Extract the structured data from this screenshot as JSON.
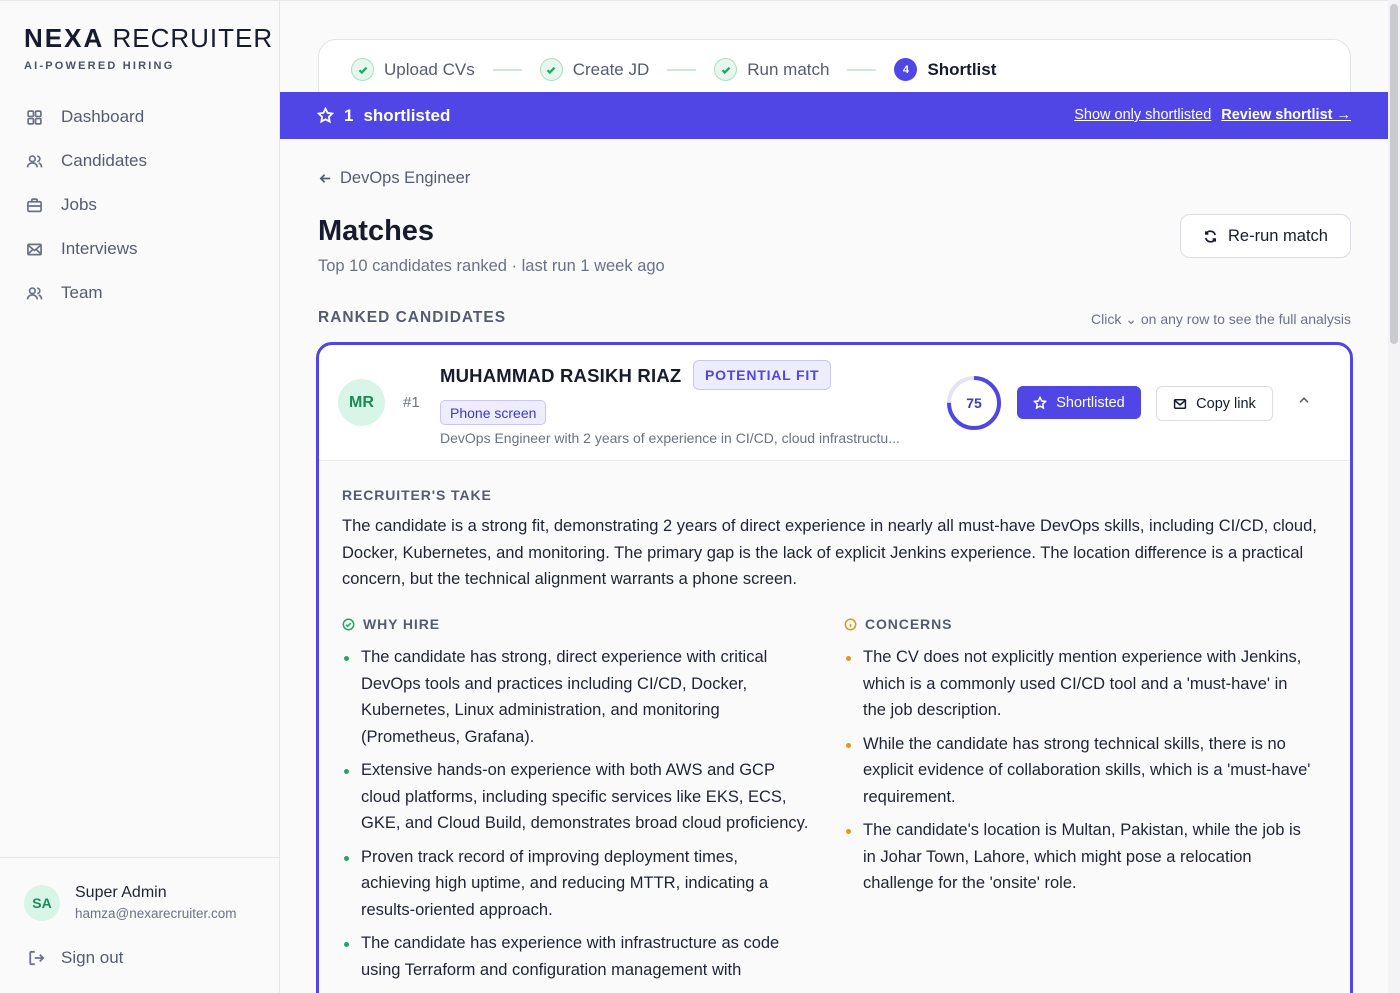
{
  "brand": {
    "name_bold": "NEXA",
    "name_rest": "RECRUITER",
    "tagline": "AI-POWERED HIRING"
  },
  "nav": [
    {
      "label": "Dashboard",
      "icon": "grid-icon"
    },
    {
      "label": "Candidates",
      "icon": "users-icon"
    },
    {
      "label": "Jobs",
      "icon": "briefcase-icon"
    },
    {
      "label": "Interviews",
      "icon": "mail-icon"
    },
    {
      "label": "Team",
      "icon": "team-icon"
    }
  ],
  "user": {
    "initials": "SA",
    "name": "Super Admin",
    "email": "hamza@nexarecruiter.com"
  },
  "signout_label": "Sign out",
  "stepper": {
    "steps": [
      {
        "label": "Upload CVs",
        "state": "done"
      },
      {
        "label": "Create JD",
        "state": "done"
      },
      {
        "label": "Run match",
        "state": "done"
      },
      {
        "label": "Shortlist",
        "state": "active",
        "number": "4"
      }
    ]
  },
  "banner": {
    "count": "1",
    "count_label": "shortlisted",
    "show_only_label": "Show only shortlisted",
    "review_label": "Review shortlist →"
  },
  "page": {
    "back_label": "DevOps Engineer",
    "title": "Matches",
    "subtitle": "Top 10 candidates ranked · last run 1 week ago",
    "rerun_label": "Re-run match",
    "section_label": "RANKED CANDIDATES",
    "hint": "Click ⌄ on any row to see the full analysis"
  },
  "candidate": {
    "initials": "MR",
    "rank": "#1",
    "name": "MUHAMMAD RASIKH RIAZ",
    "fit": "POTENTIAL FIT",
    "stage": "Phone screen",
    "summary": "DevOps Engineer with 2 years of experience in CI/CD, cloud infrastructu...",
    "score": 75,
    "score_label": "75",
    "shortlisted_label": "Shortlisted",
    "copy_link_label": "Copy link",
    "take_label": "RECRUITER'S TAKE",
    "take": "The candidate is a strong fit, demonstrating 2 years of direct experience in nearly all must-have DevOps skills, including CI/CD, cloud, Docker, Kubernetes, and monitoring. The primary gap is the lack of explicit Jenkins experience. The location difference is a practical concern, but the technical alignment warrants a phone screen.",
    "why_hire_label": "WHY HIRE",
    "why_hire": [
      "The candidate has strong, direct experience with critical DevOps tools and practices including CI/CD, Docker, Kubernetes, Linux administration, and monitoring (Prometheus, Grafana).",
      "Extensive hands-on experience with both AWS and GCP cloud platforms, including specific services like EKS, ECS, GKE, and Cloud Build, demonstrates broad cloud proficiency.",
      "Proven track record of improving deployment times, achieving high uptime, and reducing MTTR, indicating a results-oriented approach.",
      "The candidate has experience with infrastructure as code using Terraform and configuration management with"
    ],
    "concerns_label": "CONCERNS",
    "concerns": [
      "The CV does not explicitly mention experience with Jenkins, which is a commonly used CI/CD tool and a 'must-have' in the job description.",
      "While the candidate has strong technical skills, there is no explicit evidence of collaboration skills, which is a 'must-have' requirement.",
      "The candidate's location is Multan, Pakistan, while the job is in Johar Town, Lahore, which might pose a relocation challenge for the 'onsite' role."
    ]
  },
  "colors": {
    "accent": "#4f46e5",
    "success": "#22a565",
    "warning": "#d99a1e"
  }
}
